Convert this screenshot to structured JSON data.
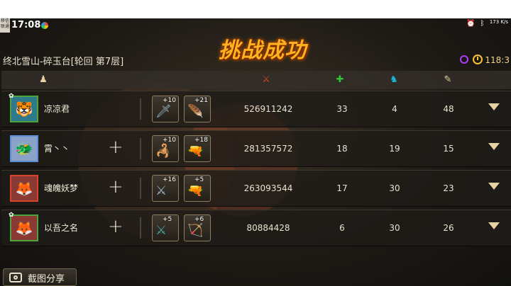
{
  "status_bar": {
    "time": "17:08",
    "carrier_badge": "移信\n联通",
    "speed": "173 K/s",
    "icons": [
      "alarm-icon",
      "bluetooth-icon"
    ]
  },
  "banner": {
    "text": "挑战成功"
  },
  "location": "终北雪山-碎玉台[轮回  第7层]",
  "timer": {
    "value": "118:3"
  },
  "columns": {
    "icons": [
      "player-icon",
      "damage-icon",
      "heal-icon",
      "buff-icon",
      "hit-icon"
    ],
    "colors": {
      "damage": "#e0442a",
      "heal": "#2fc43a",
      "buff": "#1eb6d8",
      "hit": "#e6d2a2"
    }
  },
  "rows": [
    {
      "name": "凉凉君",
      "frame_color": "#4aa63a",
      "has_plus": false,
      "items": [
        {
          "level": "+10",
          "icon": "sword-icon"
        },
        {
          "level": "+21",
          "icon": "feather-icon"
        }
      ],
      "damage": "526911242",
      "heal": "33",
      "buff": "4",
      "hit": "48"
    },
    {
      "name": "霄丶丶",
      "frame_color": "#5b8fd8",
      "has_plus": true,
      "items": [
        {
          "level": "+10",
          "icon": "staff-icon"
        },
        {
          "level": "+18",
          "icon": "gun-icon"
        }
      ],
      "damage": "281357572",
      "heal": "18",
      "buff": "19",
      "hit": "15"
    },
    {
      "name": "魂魄妖梦",
      "frame_color": "#d8442a",
      "has_plus": true,
      "items": [
        {
          "level": "+16",
          "icon": "blade-icon"
        },
        {
          "level": "+5",
          "icon": "pistol-icon"
        }
      ],
      "damage": "263093544",
      "heal": "17",
      "buff": "30",
      "hit": "23"
    },
    {
      "name": "以吾之名",
      "frame_color": "#4aa63a",
      "has_plus": true,
      "items": [
        {
          "level": "+5",
          "icon": "blade-icon"
        },
        {
          "level": "+6",
          "icon": "bow-icon"
        }
      ],
      "damage": "80884428",
      "heal": "6",
      "buff": "30",
      "hit": "26"
    }
  ],
  "share_button": {
    "label": "截图分享"
  }
}
